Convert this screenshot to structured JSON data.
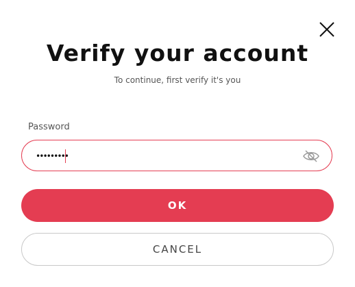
{
  "dialog": {
    "title": "Verify your account",
    "subtitle": "To continue, first verify it's you",
    "close_icon": "close-icon"
  },
  "password": {
    "label": "Password",
    "masked_value": "•••••••••",
    "toggle_icon": "eye-slash-icon"
  },
  "actions": {
    "ok_label": "OK",
    "cancel_label": "CANCEL"
  },
  "colors": {
    "accent": "#e43d52",
    "text": "#111111",
    "muted": "#555555",
    "border_neutral": "#c8c8c8"
  }
}
